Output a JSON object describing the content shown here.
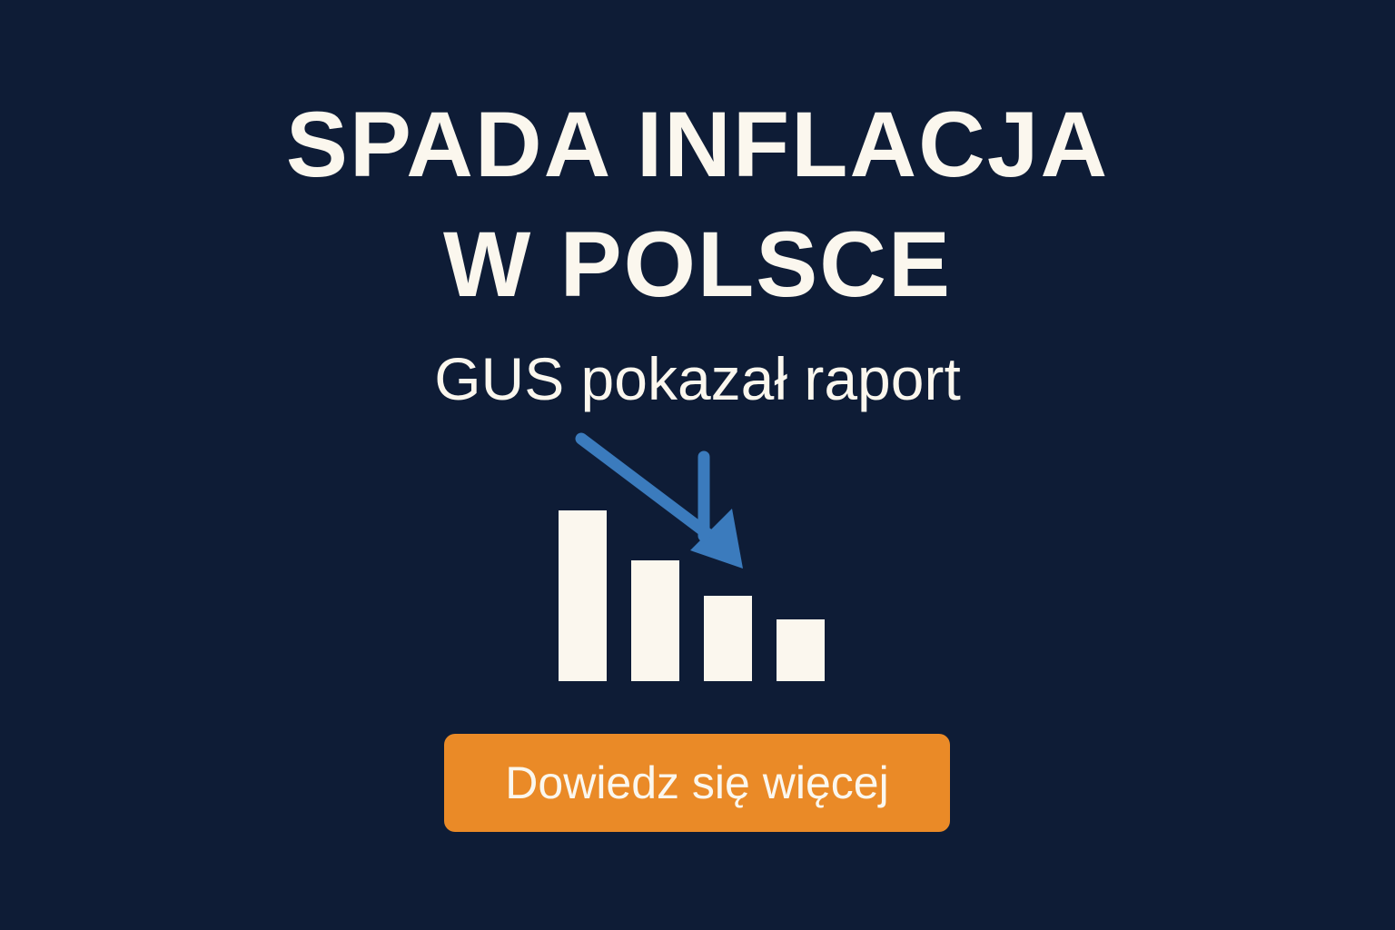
{
  "headline": {
    "line1": "SPADA INFLACJA",
    "line2": "W POLSCE"
  },
  "subtitle": "GUS pokazał raport",
  "graphic": {
    "icon": "declining-bar-chart-icon",
    "arrows": [
      "trend-down-arrow-icon",
      "down-arrow-icon"
    ],
    "bar_levels": [
      1.0,
      0.71,
      0.5,
      0.36
    ],
    "colors": {
      "bars": "#fbf7ee",
      "arrows": "#3b7bbd"
    }
  },
  "cta": {
    "label": "Dowiedz się więcej",
    "color": "#ea8a27"
  },
  "colors": {
    "background": "#0e1c36",
    "text": "#fbf7ee"
  }
}
